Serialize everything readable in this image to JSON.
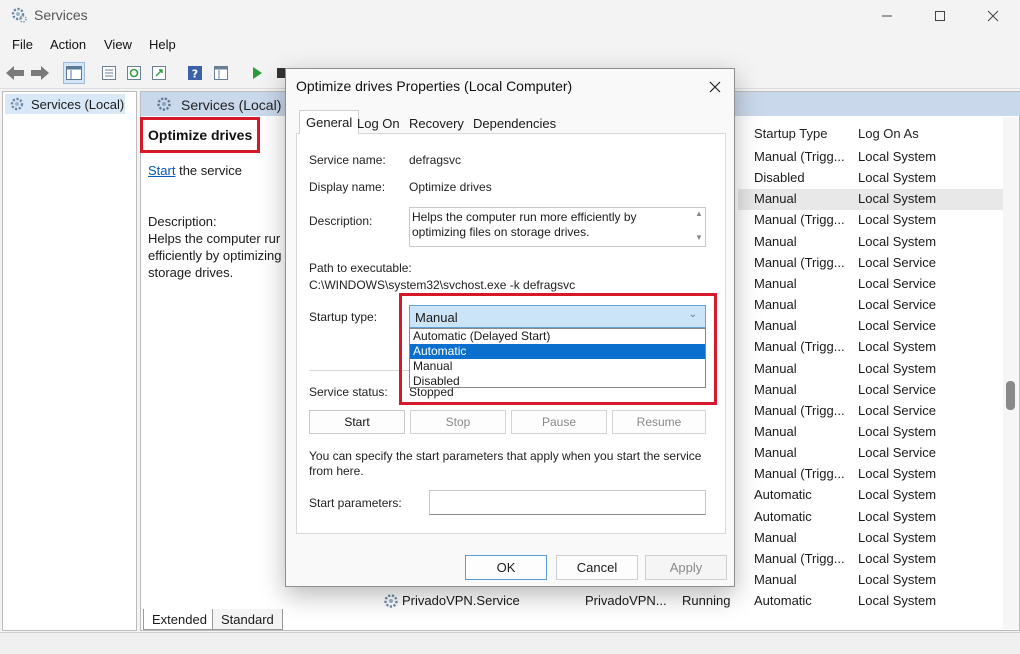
{
  "window": {
    "title": "Services",
    "minimize_icon": "minimize-icon",
    "maximize_icon": "maximize-icon",
    "close_icon": "close-icon"
  },
  "menu": [
    "File",
    "Action",
    "View",
    "Help"
  ],
  "tree": {
    "root_label": "Services (Local)"
  },
  "main": {
    "header": "Services (Local)",
    "selected_service": "Optimize drives",
    "start_link": "Start",
    "start_suffix": " the service",
    "description_label": "Description:",
    "description_text": "Helps the computer rur efficiently by optimizing storage drives."
  },
  "columns": {
    "startup_type": "Startup Type",
    "log_on_as": "Log On As"
  },
  "rows": [
    {
      "startup": "Manual (Trigg...",
      "logon": "Local System"
    },
    {
      "startup": "Disabled",
      "logon": "Local System"
    },
    {
      "startup": "Manual",
      "logon": "Local System"
    },
    {
      "startup": "Manual (Trigg...",
      "logon": "Local System"
    },
    {
      "startup": "Manual",
      "logon": "Local System"
    },
    {
      "startup": "Manual (Trigg...",
      "logon": "Local Service"
    },
    {
      "startup": "Manual",
      "logon": "Local Service"
    },
    {
      "startup": "Manual",
      "logon": "Local Service"
    },
    {
      "startup": "Manual",
      "logon": "Local Service"
    },
    {
      "startup": "Manual (Trigg...",
      "logon": "Local System"
    },
    {
      "startup": "Manual",
      "logon": "Local System"
    },
    {
      "startup": "Manual",
      "logon": "Local Service"
    },
    {
      "startup": "Manual (Trigg...",
      "logon": "Local Service"
    },
    {
      "startup": "Manual",
      "logon": "Local System"
    },
    {
      "startup": "Manual",
      "logon": "Local Service"
    },
    {
      "startup": "Manual (Trigg...",
      "logon": "Local System"
    },
    {
      "startup": "Automatic",
      "logon": "Local System"
    },
    {
      "startup": "Automatic",
      "logon": "Local System"
    },
    {
      "startup": "Manual",
      "logon": "Local System"
    },
    {
      "startup": "Manual (Trigg...",
      "logon": "Local System"
    },
    {
      "startup": "Manual",
      "logon": "Local System"
    }
  ],
  "bottom_row": {
    "name": "PrivadoVPN.Service",
    "description": "PrivadoVPN...",
    "status": "Running",
    "startup": "Automatic",
    "logon": "Local System"
  },
  "bottom_tabs": [
    "Extended",
    "Standard"
  ],
  "dialog": {
    "title": "Optimize drives Properties (Local Computer)",
    "tabs": [
      "General",
      "Log On",
      "Recovery",
      "Dependencies"
    ],
    "service_name_label": "Service name:",
    "service_name": "defragsvc",
    "display_name_label": "Display name:",
    "display_name": "Optimize drives",
    "description_label": "Description:",
    "description": "Helps the computer run more efficiently by optimizing files on storage drives.",
    "path_label": "Path to executable:",
    "path": "C:\\WINDOWS\\system32\\svchost.exe -k defragsvc",
    "startup_type_label": "Startup type:",
    "startup_type_value": "Manual",
    "startup_options": [
      "Automatic (Delayed Start)",
      "Automatic",
      "Manual",
      "Disabled"
    ],
    "highlighted_option": "Automatic",
    "service_status_label": "Service status:",
    "service_status": "Stopped",
    "buttons": {
      "start": "Start",
      "stop": "Stop",
      "pause": "Pause",
      "resume": "Resume"
    },
    "hint": "You can specify the start parameters that apply when you start the service from here.",
    "start_params_label": "Start parameters:",
    "ok": "OK",
    "cancel": "Cancel",
    "apply": "Apply"
  }
}
